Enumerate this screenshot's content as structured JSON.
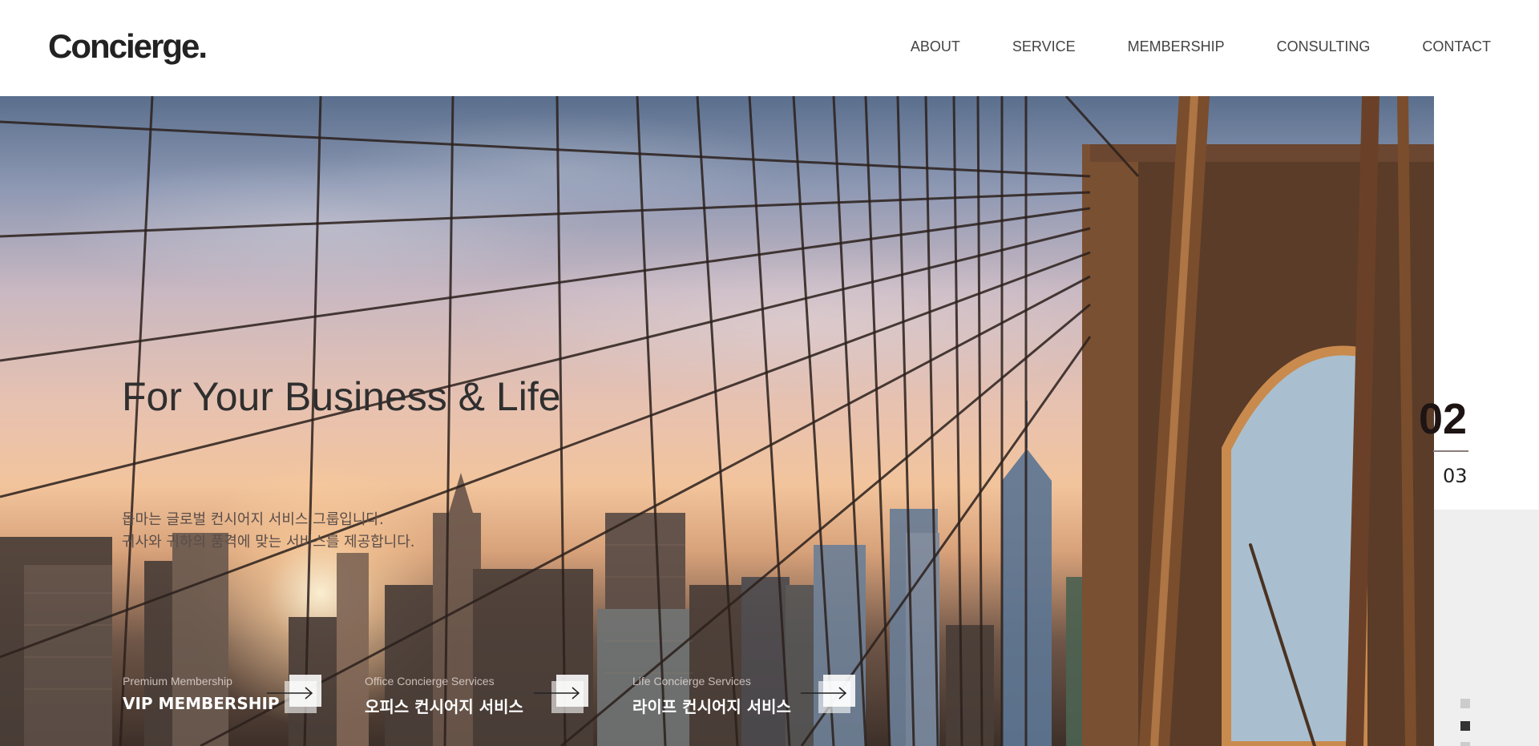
{
  "header": {
    "logo": "Concierge.",
    "nav": [
      "ABOUT",
      "SERVICE",
      "MEMBERSHIP",
      "CONSULTING",
      "CONTACT"
    ]
  },
  "hero": {
    "title": "For Your Business & Life",
    "desc": [
      "돕마는 글로벌 컨시어지 서비스 그룹입니다.",
      "귀사와 귀하의 품격에 맞는 서비스를 제공합니다."
    ]
  },
  "services": [
    {
      "sub": "Premium Membership",
      "label": "VIP MEMBERSHIP"
    },
    {
      "sub": "Office Concierge Services",
      "label": "오피스 컨시어지 서비스"
    },
    {
      "sub": "Life Concierge Services",
      "label": "라이프 컨시어지 서비스"
    }
  ],
  "slider": {
    "current": "02",
    "total": "03",
    "dots": [
      "inactive",
      "active",
      "inactive"
    ]
  },
  "colors": {
    "text_dark": "#222222",
    "panel_grey": "#efefef",
    "dot_active": "#333333",
    "dot_inactive": "#cccccc"
  }
}
